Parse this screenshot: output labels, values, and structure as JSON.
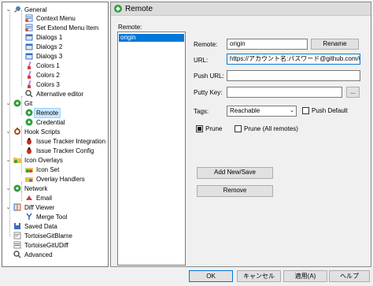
{
  "tree": {
    "items": [
      {
        "label": "General",
        "icon": "wrench-gear-icon",
        "expanded": true
      },
      {
        "label": "Context Menu",
        "icon": "context-menu-icon"
      },
      {
        "label": "Set Extend Menu Item",
        "icon": "context-menu-icon"
      },
      {
        "label": "Dialogs 1",
        "icon": "dialog-icon"
      },
      {
        "label": "Dialogs 2",
        "icon": "dialog-icon"
      },
      {
        "label": "Dialogs 3",
        "icon": "dialog-icon"
      },
      {
        "label": "Colors 1",
        "icon": "colors-icon"
      },
      {
        "label": "Colors 2",
        "icon": "colors-icon"
      },
      {
        "label": "Colors 3",
        "icon": "colors-icon"
      },
      {
        "label": "Alternative editor",
        "icon": "editor-icon"
      },
      {
        "label": "Git",
        "icon": "git-icon",
        "expanded": true
      },
      {
        "label": "Remote",
        "icon": "git-remote-icon",
        "selected": true
      },
      {
        "label": "Credential",
        "icon": "git-credential-icon"
      },
      {
        "label": "Hook Scripts",
        "icon": "hook-icon",
        "expanded": true
      },
      {
        "label": "Issue Tracker Integration",
        "icon": "bug-icon"
      },
      {
        "label": "Issue Tracker Config",
        "icon": "bug-icon"
      },
      {
        "label": "Icon Overlays",
        "icon": "overlay-icon",
        "expanded": true
      },
      {
        "label": "Icon Set",
        "icon": "icon-set-icon"
      },
      {
        "label": "Overlay Handlers",
        "icon": "overlay-handler-icon"
      },
      {
        "label": "Network",
        "icon": "network-icon",
        "expanded": true
      },
      {
        "label": "Email",
        "icon": "email-icon"
      },
      {
        "label": "Diff Viewer",
        "icon": "diff-icon",
        "expanded": true
      },
      {
        "label": "Merge Tool",
        "icon": "merge-icon"
      },
      {
        "label": "Saved Data",
        "icon": "saved-data-icon"
      },
      {
        "label": "TortoiseGitBlame",
        "icon": "blame-icon"
      },
      {
        "label": "TortoiseGitUDiff",
        "icon": "udiff-icon"
      },
      {
        "label": "Advanced",
        "icon": "advanced-icon"
      }
    ]
  },
  "panel": {
    "title": "Remote",
    "remote_list_label": "Remote:",
    "remotes": [
      "origin"
    ],
    "remote_label": "Remote:",
    "remote_value": "origin",
    "rename_label": "Rename",
    "url_label": "URL:",
    "url_value": "https://アカウント名:パスワード@github.com/〇〇〇/",
    "push_url_label": "Push URL:",
    "push_url_value": "",
    "putty_key_label": "Putty Key:",
    "putty_key_value": "",
    "browse_label": "...",
    "tags_label": "Tags:",
    "tags_value": "Reachable",
    "push_default_label": "Push Default",
    "push_default_checked": false,
    "prune_label": "Prune",
    "prune_checked": true,
    "prune_all_label": "Prune (All remotes)",
    "prune_all_checked": false,
    "add_new_save_label": "Add New/Save",
    "remove_label": "Remove"
  },
  "footer": {
    "ok_label": "OK",
    "cancel_label": "キャンセル",
    "apply_label": "適用(A)",
    "help_label": "ヘルプ"
  },
  "colors": {
    "selection": "#0078d7",
    "git_green": "#2f9e3d"
  }
}
